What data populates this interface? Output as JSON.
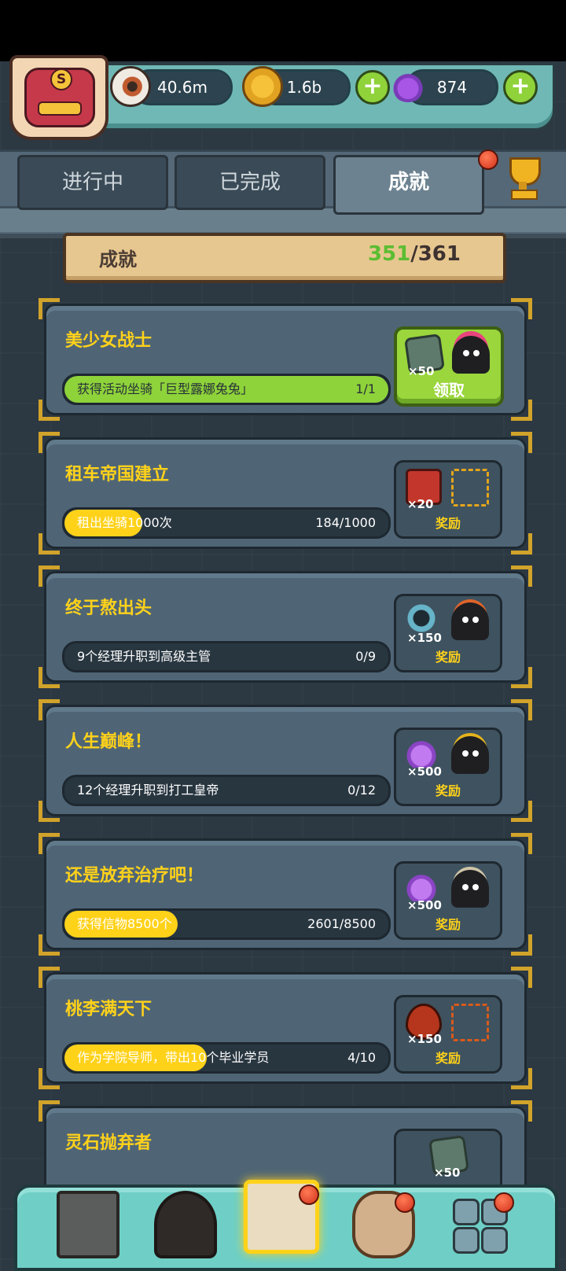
{
  "resources": {
    "eyes": "40.6m",
    "coins": "1.6b",
    "potions": "874",
    "plus_label": "+"
  },
  "tabs": [
    "进行中",
    "已完成",
    "成就"
  ],
  "summary": {
    "title": "成就",
    "completed": "351",
    "total": "/361"
  },
  "achievements": [
    {
      "name": "美少女战士",
      "desc": "获得活动坐骑「巨型露娜兔兔」",
      "progress": "1/1",
      "progress_fraction": 1.0,
      "reward_qty": "×50",
      "reward_label": "领取",
      "claimable": true,
      "reward_icon": "map-icon"
    },
    {
      "name": "租车帝国建立",
      "desc": "租出坐骑1000次",
      "progress": "184/1000",
      "progress_fraction": 0.184,
      "reward_qty": "×20",
      "reward_label": "奖励",
      "claimable": false,
      "reward_icon": "barrel-icon"
    },
    {
      "name": "终于熬出头",
      "desc": "9个经理升职到高级主管",
      "progress": "0/9",
      "progress_fraction": 0.0,
      "reward_qty": "×150",
      "reward_label": "奖励",
      "claimable": false,
      "reward_icon": "ring-icon"
    },
    {
      "name": "人生巅峰！",
      "desc": "12个经理升职到打工皇帝",
      "progress": "0/12",
      "progress_fraction": 0.0,
      "reward_qty": "×500",
      "reward_label": "奖励",
      "claimable": false,
      "reward_icon": "potion-icon"
    },
    {
      "name": "还是放弃治疗吧！",
      "desc": "获得信物8500个",
      "progress": "2601/8500",
      "progress_fraction": 0.306,
      "reward_qty": "×500",
      "reward_label": "奖励",
      "claimable": false,
      "reward_icon": "potion-icon"
    },
    {
      "name": "桃李满天下",
      "desc": "作为学院导师，带出10个毕业学员",
      "progress": "4/10",
      "progress_fraction": 0.4,
      "reward_qty": "×150",
      "reward_label": "奖励",
      "claimable": false,
      "reward_icon": "blood-drop-icon"
    },
    {
      "name": "灵石抛弃者",
      "desc": "",
      "progress": "",
      "progress_fraction": 0.0,
      "reward_qty": "×50",
      "reward_label": "",
      "claimable": false,
      "reward_icon": "map-icon"
    }
  ],
  "colors": {
    "accent": "#ffd21a",
    "progress_green": "#8ed33a",
    "card": "#4f6576"
  }
}
